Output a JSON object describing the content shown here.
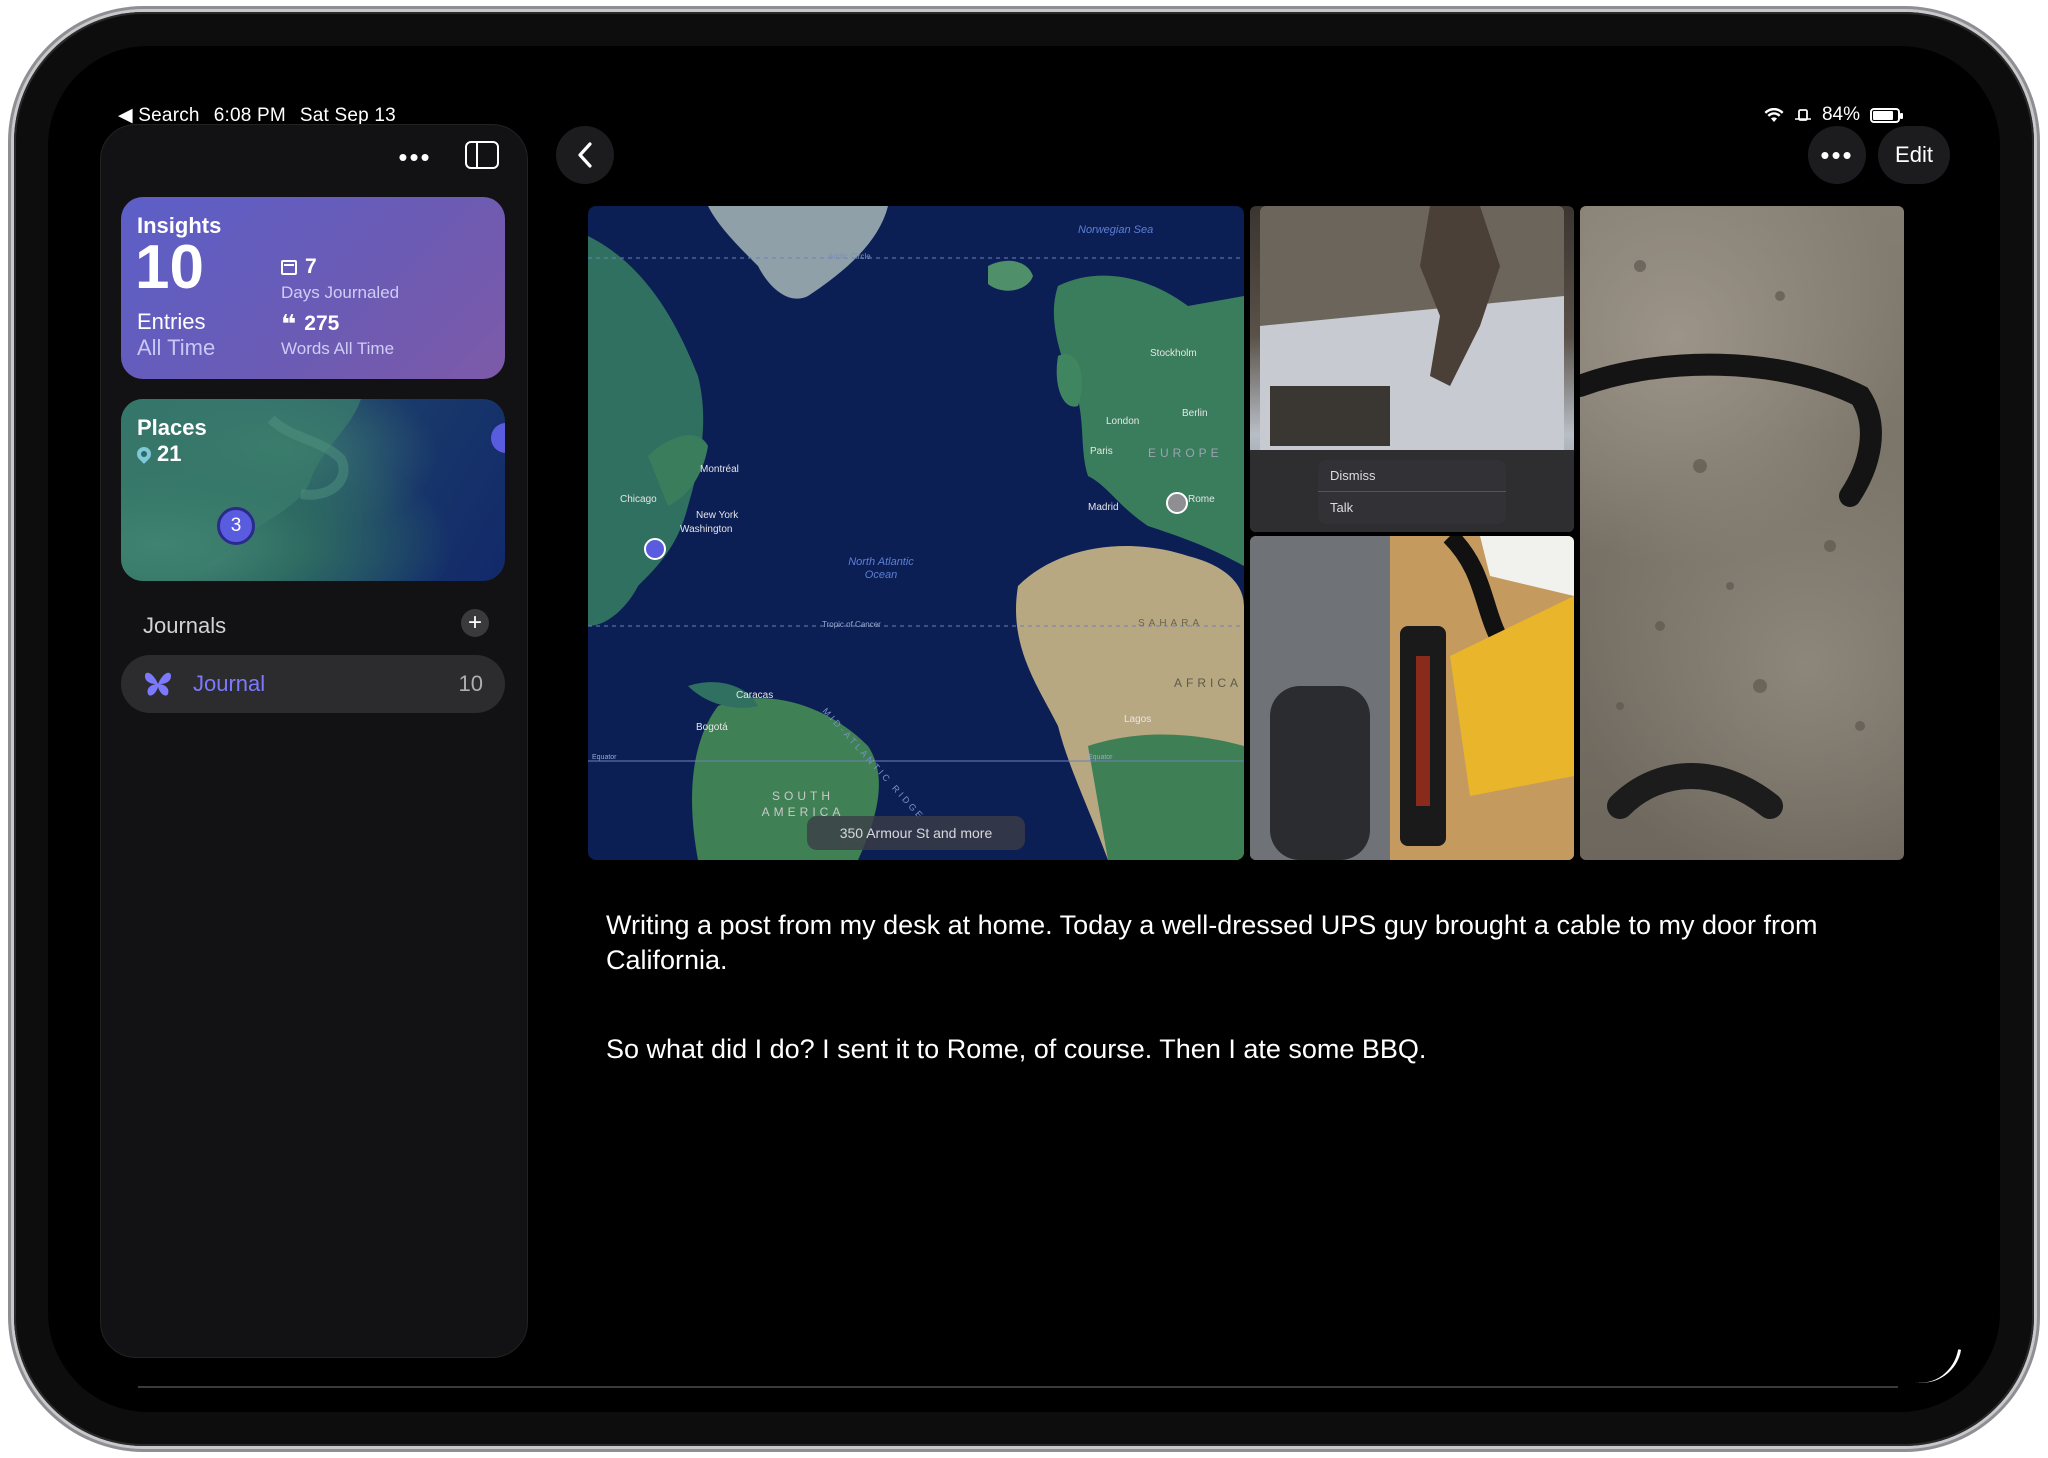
{
  "status_bar": {
    "back_label": "◀ Search",
    "time": "6:08 PM",
    "date": "Sat Sep 13",
    "battery": "84%",
    "battery_level": 0.84
  },
  "sidebar": {
    "more_icon": "ellipsis-icon",
    "toggle_icon": "sidebar-toggle-icon",
    "insights": {
      "title": "Insights",
      "entries_count": "10",
      "entries_label": "Entries",
      "entries_period": "All Time",
      "days_count": "7",
      "days_label": "Days Journaled",
      "words_count": "275",
      "words_label": "Words All Time"
    },
    "places": {
      "title": "Places",
      "count": "21",
      "cluster_count": "3"
    },
    "journals": {
      "heading": "Journals",
      "add_symbol": "+",
      "items": [
        {
          "label": "Journal",
          "count": "10",
          "color": "#7c79ff"
        }
      ]
    }
  },
  "toolbar": {
    "edit_label": "Edit",
    "more_symbol": "•••"
  },
  "entry": {
    "map": {
      "caption": "350 Armour St and more",
      "labels": {
        "norwegian_sea": "Norwegian Sea",
        "arctic_circle": "Arctic Circle",
        "stockholm": "Stockholm",
        "london": "London",
        "berlin": "Berlin",
        "paris": "Paris",
        "europe": "EUROPE",
        "rome": "Rome",
        "madrid": "Madrid",
        "montreal": "Montréal",
        "chicago": "Chicago",
        "new_york": "New York",
        "washington": "Washington",
        "north_atlantic": "North Atlantic Ocean",
        "tropic": "Tropic of Cancer",
        "sahara": "SAHARA",
        "africa": "AFRICA",
        "caracas": "Caracas",
        "bogota": "Bogotá",
        "lagos": "Lagos",
        "ridge": "MID-ATLANTIC RIDGE",
        "equator_left": "Equator",
        "equator_right": "Equator",
        "south_america": "SOUTH AMERICA"
      }
    },
    "photo_dialog": {
      "dismiss": "Dismiss",
      "talk": "Talk"
    },
    "paragraphs": [
      "Writing a post from my desk at home. Today a well-dressed UPS guy brought a cable to my door from California.",
      "So what did I do? I sent it to Rome, of course. Then I ate some BBQ."
    ]
  },
  "colors": {
    "accent": "#7c79ff",
    "insights_gradient_start": "#5c5fc8",
    "insights_gradient_end": "#7d5aa8",
    "background": "#000000"
  }
}
